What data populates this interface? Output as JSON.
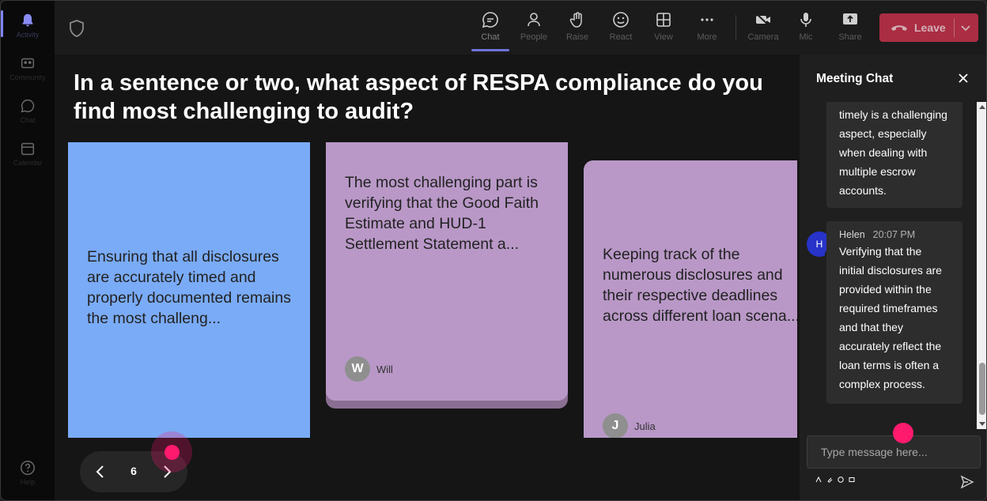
{
  "rail": {
    "items": [
      {
        "label": "Activity",
        "icon": "bell-icon"
      },
      {
        "label": "Community",
        "icon": "community-icon"
      },
      {
        "label": "Chat",
        "icon": "chat-icon"
      },
      {
        "label": "Calendar",
        "icon": "calendar-icon"
      },
      {
        "label": "Help",
        "icon": "help-icon"
      }
    ]
  },
  "topbar": {
    "buttons": [
      {
        "label": "Chat",
        "icon": "chat-bubble-icon"
      },
      {
        "label": "People",
        "icon": "people-icon"
      },
      {
        "label": "Raise",
        "icon": "raise-hand-icon"
      },
      {
        "label": "React",
        "icon": "smiley-icon"
      },
      {
        "label": "View",
        "icon": "grid-icon"
      },
      {
        "label": "More",
        "icon": "more-icon"
      },
      {
        "label": "Camera",
        "icon": "camera-icon"
      },
      {
        "label": "Mic",
        "icon": "microphone-icon"
      },
      {
        "label": "Share",
        "icon": "share-icon"
      }
    ],
    "leave_label": "Leave"
  },
  "stage": {
    "question": "In a sentence or two, what aspect of RESPA compliance do you find most challenging to audit?",
    "cards": [
      {
        "text": "Ensuring that all disclosures are accurately timed and properly documented remains the most challeng...",
        "color": "#7aabf6"
      },
      {
        "text": "The most challenging part is verifying that the Good Faith Estimate and HUD-1 Settlement Statement a...",
        "author_initial": "W",
        "author": "Will",
        "color": "#b998c7"
      },
      {
        "text": "Keeping track of the numerous disclosures and their respective deadlines across different loan scena...",
        "author_initial": "J",
        "author": "Julia",
        "color": "#b998c7"
      }
    ],
    "pager": {
      "page": "6"
    }
  },
  "chat": {
    "title": "Meeting Chat",
    "messages": [
      {
        "text": "timely is a challenging aspect, especially when dealing with multiple escrow accounts."
      },
      {
        "avatar": "H",
        "sender": "Helen",
        "time": "20:07 PM",
        "text": "Verifying that the initial disclosures are provided within the required timeframes and that they accurately reflect the loan terms is often a complex process."
      }
    ],
    "compose_placeholder": "Type message here..."
  },
  "colors": {
    "accent": "#7f85f5",
    "leave": "#c4314b",
    "avatar": "#2733c9",
    "cursor": "#ff1a6e"
  }
}
